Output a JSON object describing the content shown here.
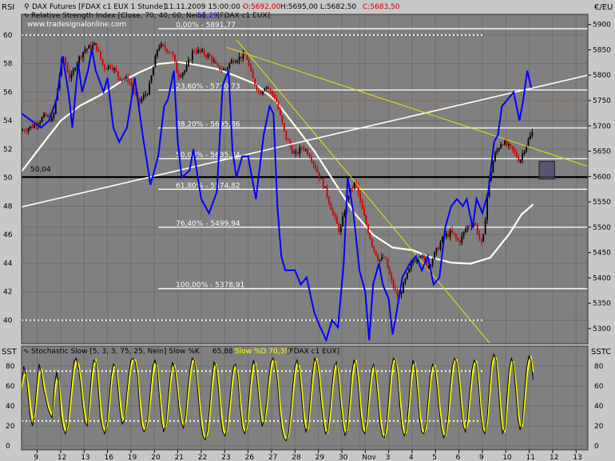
{
  "upper_panel": {
    "left_label": "RSI",
    "right_label": "€/EU",
    "header_symbol": "DAX Futures [FDAX c1 EUX  1 Stunde]",
    "header_datetime": "11.11.2009 15:00:00 -",
    "header_open": "O:5692,00",
    "header_high_low": "H:5695,00 L:5682,50",
    "header_close": "C:5683,50",
    "rsi_indicator_label": "Relative Strength Index [Close, 70, 40, 60, Nein]",
    "rsi_value": "56,29",
    "rsi_instrument": "[FDAX c1 EUX]",
    "watermark": "www.tradesignalonline.com",
    "rsi_level_label": "50,04",
    "fib_levels": [
      {
        "label": "0,00% - 5891,77",
        "price": 5891.77
      },
      {
        "label": "23,60% - 5770,73",
        "price": 5770.73
      },
      {
        "label": "38,20% - 5695,86",
        "price": 5695.86
      },
      {
        "label": "50,00% - 5635,34",
        "price": 5635.34
      },
      {
        "label": "61,80% - 5574,82",
        "price": 5574.82
      },
      {
        "label": "76,40% - 5499,94",
        "price": 5499.94
      },
      {
        "label": "100,00% - 5378,91",
        "price": 5378.91
      }
    ],
    "colors": {
      "background": "#808080",
      "up_candle": "#000000",
      "down_candle": "#cc0000",
      "rsi_line": "#0000ff",
      "moving_average": "#fffff0",
      "trendline": "#e8e800",
      "fib": "#ffffff",
      "zone": "#484868"
    }
  },
  "lower_panel": {
    "left_label": "SST",
    "right_label": "SSTC",
    "indicator_label": "Stochastic Slow [5, 3, 3, 75, 25, Nein]  Slow %K",
    "k_value": "65,88",
    "d_value": "Slow %D 70,39",
    "instrument": "[FDAX c1 EUX]",
    "colors": {
      "k_line": "#000000",
      "d_line": "#ffff00",
      "bands": "#ffffff"
    }
  },
  "x_axis": {
    "ticks": [
      "9",
      "12",
      "13",
      "16",
      "19",
      "20",
      "21",
      "22",
      "23",
      "26",
      "27",
      "28",
      "29",
      "30",
      "Nov",
      "3",
      "4",
      "5",
      "6",
      "9",
      "10",
      "11",
      "12",
      "13"
    ]
  },
  "chart_data": [
    {
      "type": "line",
      "title": "DAX Futures [FDAX c1 EUX  1 Stunde]",
      "price_axis": {
        "ylim": [
          5270,
          5920
        ],
        "ticks": [
          5900,
          5850,
          5800,
          5750,
          5700,
          5650,
          5600,
          5550,
          5500,
          5450,
          5400,
          5350,
          5300
        ]
      },
      "rsi_axis": {
        "ylim": [
          38.35,
          61.45
        ],
        "ticks": [
          60,
          58,
          56,
          54,
          52,
          50,
          48,
          46,
          44,
          42,
          40
        ]
      },
      "rsi_reference_levels": [
        60,
        50.04,
        40
      ],
      "price_path": [
        [
          0,
          5690
        ],
        [
          6,
          5700
        ],
        [
          12,
          5720
        ],
        [
          16,
          5710
        ],
        [
          21,
          5840
        ],
        [
          25,
          5790
        ],
        [
          28,
          5825
        ],
        [
          32,
          5850
        ],
        [
          38,
          5860
        ],
        [
          42,
          5815
        ],
        [
          46,
          5820
        ],
        [
          50,
          5795
        ],
        [
          55,
          5790
        ],
        [
          60,
          5745
        ],
        [
          65,
          5770
        ],
        [
          70,
          5860
        ],
        [
          77,
          5845
        ],
        [
          80,
          5800
        ],
        [
          84,
          5810
        ],
        [
          88,
          5850
        ],
        [
          92,
          5845
        ],
        [
          97,
          5835
        ],
        [
          100,
          5815
        ],
        [
          104,
          5810
        ],
        [
          108,
          5830
        ],
        [
          115,
          5840
        ],
        [
          118,
          5795
        ],
        [
          122,
          5765
        ],
        [
          125,
          5780
        ],
        [
          130,
          5755
        ],
        [
          135,
          5680
        ],
        [
          140,
          5640
        ],
        [
          144,
          5660
        ],
        [
          148,
          5640
        ],
        [
          152,
          5605
        ],
        [
          156,
          5570
        ],
        [
          160,
          5520
        ],
        [
          163,
          5490
        ],
        [
          167,
          5560
        ],
        [
          171,
          5590
        ],
        [
          175,
          5525
        ],
        [
          180,
          5460
        ],
        [
          183,
          5435
        ],
        [
          186,
          5440
        ],
        [
          190,
          5385
        ],
        [
          193,
          5360
        ],
        [
          196,
          5390
        ],
        [
          200,
          5430
        ],
        [
          204,
          5450
        ],
        [
          208,
          5420
        ],
        [
          212,
          5450
        ],
        [
          216,
          5480
        ],
        [
          220,
          5490
        ],
        [
          224,
          5470
        ],
        [
          228,
          5500
        ],
        [
          232,
          5510
        ],
        [
          236,
          5460
        ],
        [
          239,
          5580
        ],
        [
          242,
          5640
        ],
        [
          246,
          5670
        ],
        [
          249,
          5660
        ],
        [
          252,
          5650
        ],
        [
          255,
          5630
        ],
        [
          258,
          5660
        ],
        [
          262,
          5690
        ]
      ],
      "rsi_path": [
        [
          0,
          54.5
        ],
        [
          5,
          54.0
        ],
        [
          10,
          53.5
        ],
        [
          14,
          54.0
        ],
        [
          18,
          55.5
        ],
        [
          21,
          58.5
        ],
        [
          24,
          56.0
        ],
        [
          26,
          53.5
        ],
        [
          29,
          58.0
        ],
        [
          31,
          56.0
        ],
        [
          34,
          57.5
        ],
        [
          36,
          59.0
        ],
        [
          38,
          57.5
        ],
        [
          42,
          56.0
        ],
        [
          44,
          57.0
        ],
        [
          47,
          53.5
        ],
        [
          50,
          52.5
        ],
        [
          54,
          53.5
        ],
        [
          58,
          57.0
        ],
        [
          62,
          53.0
        ],
        [
          66,
          49.5
        ],
        [
          70,
          51.5
        ],
        [
          73,
          55.0
        ],
        [
          75,
          55.5
        ],
        [
          78,
          57.5
        ],
        [
          80,
          52.5
        ],
        [
          82,
          50.0
        ],
        [
          86,
          50.5
        ],
        [
          88,
          52.0
        ],
        [
          92,
          48.5
        ],
        [
          96,
          47.5
        ],
        [
          100,
          49.0
        ],
        [
          103,
          56.5
        ],
        [
          106,
          57.5
        ],
        [
          108,
          52.0
        ],
        [
          110,
          50.0
        ],
        [
          113,
          51.5
        ],
        [
          116,
          51.5
        ],
        [
          120,
          48.5
        ],
        [
          124,
          53.0
        ],
        [
          127,
          55.0
        ],
        [
          129,
          54.5
        ],
        [
          131,
          48.0
        ],
        [
          133,
          44.5
        ],
        [
          135,
          43.5
        ],
        [
          140,
          43.5
        ],
        [
          143,
          42.5
        ],
        [
          146,
          43.0
        ],
        [
          150,
          40.5
        ],
        [
          153,
          39.5
        ],
        [
          156,
          38.6
        ],
        [
          159,
          40.0
        ],
        [
          162,
          39.5
        ],
        [
          165,
          44.0
        ],
        [
          167,
          50.0
        ],
        [
          170,
          47.5
        ],
        [
          173,
          43.5
        ],
        [
          176,
          42.0
        ],
        [
          178,
          38.6
        ],
        [
          180,
          42.5
        ],
        [
          183,
          44.0
        ],
        [
          185,
          42.5
        ],
        [
          188,
          41.5
        ],
        [
          190,
          39.0
        ],
        [
          192,
          40.5
        ],
        [
          195,
          43.0
        ],
        [
          197,
          43.5
        ],
        [
          199,
          44.0
        ],
        [
          202,
          44.5
        ],
        [
          205,
          43.5
        ],
        [
          208,
          44.5
        ],
        [
          211,
          42.5
        ],
        [
          214,
          43.0
        ],
        [
          217,
          46.5
        ],
        [
          220,
          48.0
        ],
        [
          223,
          48.5
        ],
        [
          226,
          48.0
        ],
        [
          228,
          48.5
        ],
        [
          231,
          46.5
        ],
        [
          233,
          48.5
        ],
        [
          236,
          47.5
        ],
        [
          239,
          49.0
        ],
        [
          242,
          52.5
        ],
        [
          244,
          53.0
        ],
        [
          246,
          55.0
        ],
        [
          249,
          55.5
        ],
        [
          252,
          56.0
        ],
        [
          255,
          54.0
        ],
        [
          257,
          55.5
        ],
        [
          259,
          57.5
        ],
        [
          261,
          56.3
        ]
      ],
      "moving_average_path": [
        [
          0,
          5610
        ],
        [
          10,
          5660
        ],
        [
          20,
          5710
        ],
        [
          30,
          5740
        ],
        [
          40,
          5760
        ],
        [
          50,
          5785
        ],
        [
          60,
          5805
        ],
        [
          70,
          5822
        ],
        [
          80,
          5826
        ],
        [
          90,
          5820
        ],
        [
          100,
          5812
        ],
        [
          110,
          5798
        ],
        [
          120,
          5782
        ],
        [
          130,
          5750
        ],
        [
          140,
          5700
        ],
        [
          150,
          5650
        ],
        [
          160,
          5590
        ],
        [
          170,
          5530
        ],
        [
          180,
          5485
        ],
        [
          190,
          5460
        ],
        [
          200,
          5455
        ],
        [
          210,
          5440
        ],
        [
          220,
          5430
        ],
        [
          230,
          5428
        ],
        [
          240,
          5440
        ],
        [
          250,
          5488
        ],
        [
          256,
          5525
        ],
        [
          262,
          5545
        ]
      ],
      "trendlines": [
        {
          "from": [
            0,
            5540
          ],
          "to": [
            290,
            5800
          ]
        },
        {
          "from": [
            105,
            5855
          ],
          "to": [
            290,
            5620
          ]
        },
        {
          "from": [
            110,
            5870
          ],
          "to": [
            240,
            5270
          ]
        }
      ],
      "zone": {
        "x": [
          265,
          273
        ],
        "price": [
          5595,
          5630
        ]
      }
    },
    {
      "type": "line",
      "title": "Stochastic Slow [5, 3, 3, 75, 25, Nein]",
      "ylim": [
        -4,
        100
      ],
      "ticks": [
        80,
        60,
        40,
        20,
        0
      ],
      "reference_levels": [
        75,
        25
      ],
      "slow_k": [
        62,
        80,
        72,
        50,
        28,
        20,
        35,
        62,
        82,
        74,
        58,
        48,
        38,
        32,
        28,
        60,
        74,
        62,
        30,
        18,
        12,
        20,
        42,
        66,
        85,
        88,
        78,
        62,
        40,
        24,
        20,
        45,
        72,
        86,
        84,
        60,
        30,
        18,
        12,
        22,
        45,
        70,
        82,
        80,
        60,
        35,
        22,
        25,
        50,
        70,
        86,
        88,
        84,
        70,
        38,
        20,
        14,
        18,
        32,
        58,
        80,
        86,
        78,
        50,
        25,
        14,
        22,
        46,
        70,
        84,
        78,
        60,
        38,
        24,
        18,
        30,
        55,
        76,
        88,
        86,
        70,
        45,
        22,
        10,
        6,
        16,
        38,
        66,
        84,
        80,
        58,
        30,
        14,
        10,
        18,
        40,
        64,
        80,
        82,
        66,
        38,
        18,
        12,
        20,
        48,
        72,
        86,
        80,
        60,
        35,
        20,
        24,
        42,
        66,
        84,
        88,
        82,
        65,
        36,
        18,
        8,
        5,
        12,
        32,
        58,
        80,
        86,
        76,
        52,
        26,
        14,
        20,
        46,
        72,
        88,
        84,
        68,
        44,
        24,
        12,
        15,
        36,
        60,
        80,
        84,
        66,
        40,
        20,
        10,
        18,
        44,
        72,
        86,
        82,
        60,
        32,
        16,
        12,
        28,
        55,
        76,
        82,
        70,
        46,
        22,
        10,
        8,
        22,
        50,
        76,
        88,
        86,
        70,
        40,
        18,
        10,
        16,
        40,
        70,
        86,
        80,
        56,
        28,
        14,
        12,
        22,
        48,
        72,
        82,
        78,
        60,
        36,
        18,
        8,
        12,
        30,
        58,
        80,
        88,
        84,
        66,
        40,
        20,
        14,
        28,
        55,
        76,
        86,
        82,
        60,
        32,
        16,
        12,
        30,
        60,
        84,
        92,
        86,
        62,
        30,
        12,
        18,
        48,
        76,
        88,
        82,
        56,
        28,
        16,
        24,
        52,
        78,
        90,
        86,
        66
      ],
      "slow_d": [
        58,
        70,
        72,
        60,
        40,
        26,
        30,
        50,
        72,
        76,
        64,
        52,
        42,
        35,
        30,
        50,
        66,
        64,
        42,
        24,
        15,
        18,
        34,
        56,
        76,
        84,
        82,
        68,
        48,
        30,
        22,
        38,
        62,
        80,
        85,
        68,
        40,
        22,
        15,
        20,
        38,
        62,
        78,
        80,
        66,
        44,
        28,
        26,
        42,
        62,
        80,
        86,
        86,
        74,
        48,
        26,
        16,
        18,
        28,
        48,
        70,
        82,
        80,
        58,
        34,
        18,
        20,
        38,
        62,
        78,
        80,
        66,
        44,
        28,
        20,
        26,
        46,
        68,
        84,
        86,
        74,
        52,
        30,
        14,
        8,
        12,
        30,
        56,
        76,
        82,
        66,
        40,
        20,
        12,
        16,
        32,
        56,
        74,
        80,
        70,
        46,
        24,
        14,
        18,
        38,
        62,
        80,
        82,
        66,
        42,
        26,
        24,
        36,
        58,
        76,
        86,
        84,
        70,
        44,
        24,
        12,
        7,
        10,
        26,
        48,
        70,
        82,
        80,
        60,
        34,
        18,
        18,
        38,
        62,
        82,
        86,
        74,
        52,
        30,
        16,
        14,
        28,
        52,
        72,
        82,
        72,
        48,
        26,
        14,
        16,
        36,
        62,
        80,
        84,
        68,
        42,
        22,
        14,
        22,
        46,
        68,
        80,
        74,
        54,
        30,
        14,
        9,
        16,
        40,
        66,
        84,
        86,
        76,
        50,
        26,
        12,
        14,
        32,
        60,
        80,
        82,
        64,
        36,
        18,
        13,
        18,
        40,
        64,
        78,
        80,
        66,
        44,
        24,
        12,
        11,
        24,
        48,
        72,
        86,
        86,
        72,
        48,
        26,
        16,
        22,
        46,
        68,
        82,
        84,
        68,
        40,
        20,
        13,
        24,
        50,
        76,
        88,
        88,
        70,
        40,
        18,
        15,
        38,
        66,
        84,
        84,
        64,
        36,
        20,
        20,
        42,
        68,
        84,
        88,
        74
      ]
    }
  ]
}
